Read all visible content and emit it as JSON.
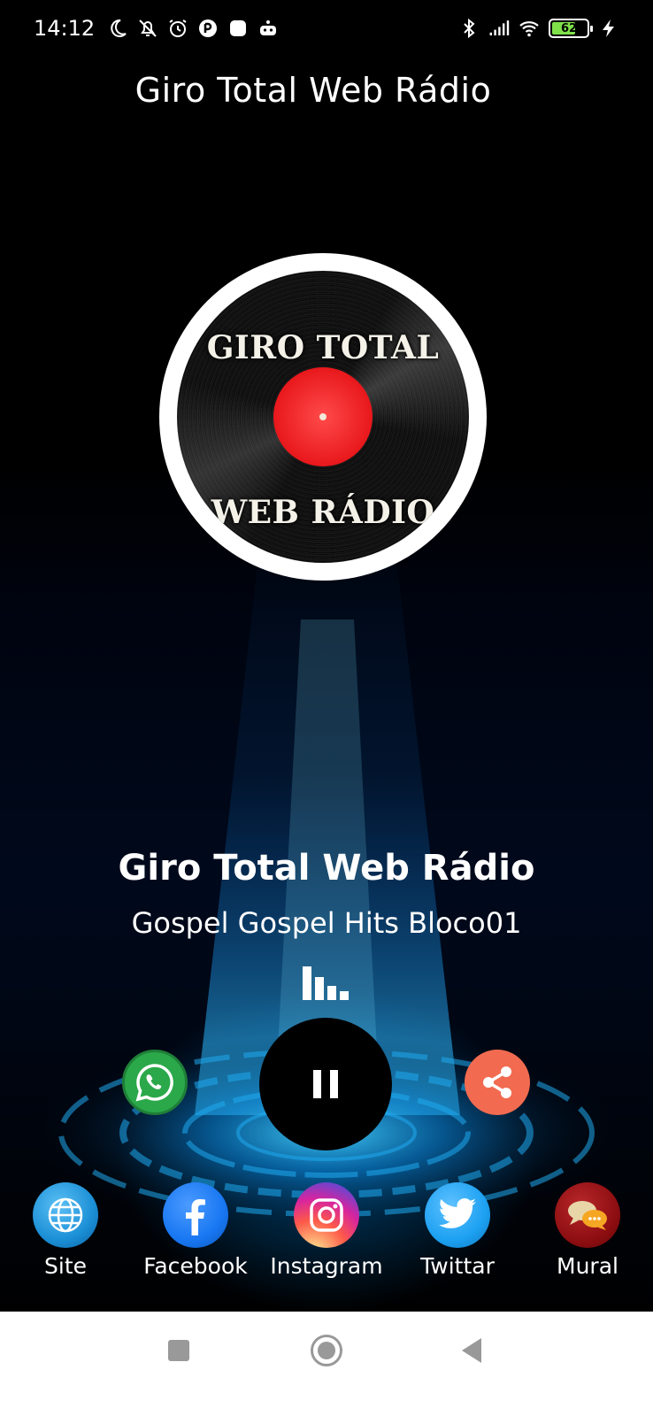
{
  "status_bar": {
    "time": "14:12",
    "battery_level": "62",
    "left_icons": [
      "moon-icon",
      "bell-off-icon",
      "alarm-icon",
      "app-icon",
      "app-square-icon",
      "robot-icon"
    ],
    "right_icons": [
      "bluetooth-icon",
      "signal-icon",
      "wifi-icon",
      "battery-icon",
      "charging-icon"
    ]
  },
  "header": {
    "title": "Giro Total Web Rádio"
  },
  "logo": {
    "top_text": "GIRO TOTAL",
    "bottom_text": "WEB RÁDIO"
  },
  "now_playing": {
    "station": "Giro Total Web Rádio",
    "track": "Gospel Gospel Hits Bloco01"
  },
  "controls": {
    "whatsapp_icon": "whatsapp-icon",
    "play_state_icon": "pause-icon",
    "share_icon": "share-icon"
  },
  "social": [
    {
      "label": "Site",
      "icon": "globe-icon",
      "color": "#1b8fd6"
    },
    {
      "label": "Facebook",
      "icon": "facebook-icon",
      "color": "#1877f2"
    },
    {
      "label": "Instagram",
      "icon": "instagram-icon",
      "color": "#d6249f"
    },
    {
      "label": "Twittar",
      "icon": "twitter-icon",
      "color": "#1da1f2"
    },
    {
      "label": "Mural",
      "icon": "chat-icon",
      "color": "#8b0d10"
    }
  ],
  "colors": {
    "background": "#000000",
    "accent_blue": "#0a7fd0",
    "whatsapp": "#2aa84a",
    "share": "#f26b50"
  }
}
